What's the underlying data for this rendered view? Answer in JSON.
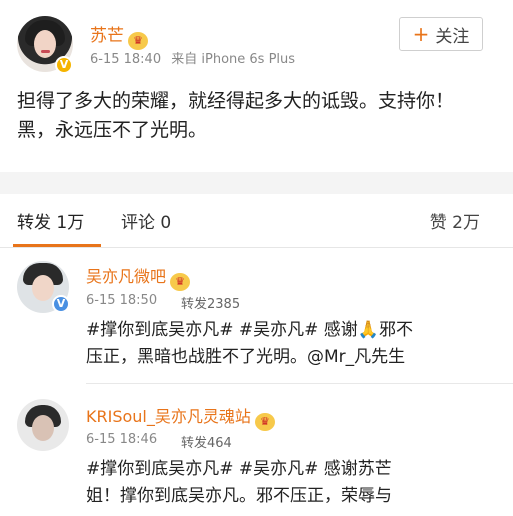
{
  "post": {
    "author": "苏芒",
    "time": "6-15 18:40",
    "source": "来自 iPhone 6s Plus",
    "follow_label": "关注",
    "text": "担得了多大的荣耀，就经得起多大的诋毁。支持你！黑，永远压不了光明。"
  },
  "tabs": {
    "repost": "转发 1万",
    "comment": "评论 0",
    "likes": "赞 2万"
  },
  "reposts": [
    {
      "author": "吴亦凡微吧",
      "time": "6-15 18:50",
      "count": "转发2385",
      "line1": "#撑你到底吴亦凡# #吴亦凡# 感谢🙏邪不",
      "line2": "压正，黑暗也战胜不了光明。@Mr_凡先生"
    },
    {
      "author": "KRISoul_吴亦凡灵魂站",
      "time": "6-15 18:46",
      "count": "转发464",
      "line1": "#撑你到底吴亦凡# #吴亦凡# 感谢苏芒",
      "line2": "姐！撑你到底吴亦凡。邪不压正，荣辱与"
    }
  ]
}
